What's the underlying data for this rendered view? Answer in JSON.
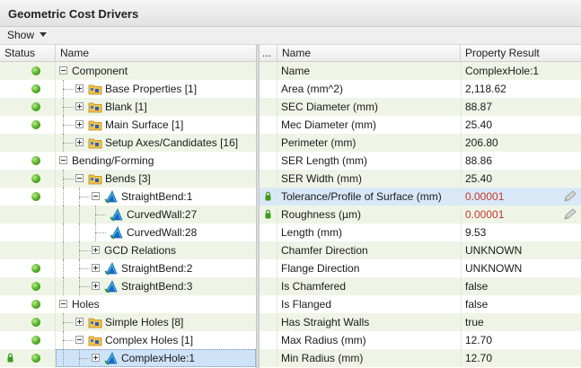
{
  "window": {
    "title": "Geometric Cost Drivers"
  },
  "toolbar": {
    "show_label": "Show"
  },
  "left_table": {
    "headers": {
      "status": "Status",
      "name": "Name"
    },
    "rows": [
      {
        "label": "Component",
        "depth": 0,
        "expander": "minus",
        "icon": "none",
        "status_dot": true,
        "lock": false
      },
      {
        "label": "Base Properties [1]",
        "depth": 1,
        "expander": "plus",
        "icon": "folder",
        "status_dot": true,
        "lock": false
      },
      {
        "label": "Blank [1]",
        "depth": 1,
        "expander": "plus",
        "icon": "folder",
        "status_dot": true,
        "lock": false
      },
      {
        "label": "Main Surface [1]",
        "depth": 1,
        "expander": "plus",
        "icon": "folder",
        "status_dot": true,
        "lock": false
      },
      {
        "label": "Setup Axes/Candidates [16]",
        "depth": 1,
        "expander": "plus",
        "icon": "folder",
        "status_dot": false,
        "lock": false
      },
      {
        "label": "Bending/Forming",
        "depth": 0,
        "expander": "minus",
        "icon": "none",
        "status_dot": true,
        "lock": false
      },
      {
        "label": "Bends [3]",
        "depth": 1,
        "expander": "minus",
        "icon": "folder",
        "status_dot": true,
        "lock": false
      },
      {
        "label": "StraightBend:1",
        "depth": 2,
        "expander": "minus",
        "icon": "feature",
        "status_dot": true,
        "lock": false
      },
      {
        "label": "CurvedWall:27",
        "depth": 3,
        "expander": "none",
        "icon": "feature",
        "status_dot": false,
        "lock": false
      },
      {
        "label": "CurvedWall:28",
        "depth": 3,
        "expander": "none",
        "icon": "feature",
        "status_dot": false,
        "lock": false
      },
      {
        "label": "GCD Relations",
        "depth": 2,
        "expander": "plus",
        "icon": "none",
        "status_dot": false,
        "lock": false
      },
      {
        "label": "StraightBend:2",
        "depth": 2,
        "expander": "plus",
        "icon": "feature",
        "status_dot": true,
        "lock": false
      },
      {
        "label": "StraightBend:3",
        "depth": 2,
        "expander": "plus",
        "icon": "feature",
        "status_dot": true,
        "lock": false
      },
      {
        "label": "Holes",
        "depth": 0,
        "expander": "minus",
        "icon": "none",
        "status_dot": true,
        "lock": false
      },
      {
        "label": "Simple Holes [8]",
        "depth": 1,
        "expander": "plus",
        "icon": "folder",
        "status_dot": true,
        "lock": false
      },
      {
        "label": "Complex Holes [1]",
        "depth": 1,
        "expander": "minus",
        "icon": "folder",
        "status_dot": true,
        "lock": false
      },
      {
        "label": "ComplexHole:1",
        "depth": 2,
        "expander": "plus",
        "icon": "feature",
        "status_dot": true,
        "lock": true,
        "selected": true
      }
    ]
  },
  "right_table": {
    "headers": {
      "marker": "...",
      "name": "Name",
      "result": "Property Result"
    },
    "rows": [
      {
        "name": "Name",
        "value": "ComplexHole:1",
        "lock": false,
        "warn": false,
        "edit": false
      },
      {
        "name": "Area (mm^2)",
        "value": "2,118.62",
        "lock": false,
        "warn": false,
        "edit": false
      },
      {
        "name": "SEC Diameter (mm)",
        "value": "88.87",
        "lock": false,
        "warn": false,
        "edit": false
      },
      {
        "name": "Mec Diameter (mm)",
        "value": "25.40",
        "lock": false,
        "warn": false,
        "edit": false
      },
      {
        "name": "Perimeter (mm)",
        "value": "206.80",
        "lock": false,
        "warn": false,
        "edit": false
      },
      {
        "name": "SER Length (mm)",
        "value": "88.86",
        "lock": false,
        "warn": false,
        "edit": false
      },
      {
        "name": "SER Width (mm)",
        "value": "25.40",
        "lock": false,
        "warn": false,
        "edit": false
      },
      {
        "name": "Tolerance/Profile of Surface (mm)",
        "value": "0.00001",
        "lock": true,
        "warn": true,
        "edit": true,
        "highlight": true
      },
      {
        "name": "Roughness (µm)",
        "value": "0.00001",
        "lock": true,
        "warn": true,
        "edit": true
      },
      {
        "name": "Length (mm)",
        "value": "9.53",
        "lock": false,
        "warn": false,
        "edit": false
      },
      {
        "name": "Chamfer Direction",
        "value": "UNKNOWN",
        "lock": false,
        "warn": false,
        "edit": false
      },
      {
        "name": "Flange Direction",
        "value": "UNKNOWN",
        "lock": false,
        "warn": false,
        "edit": false
      },
      {
        "name": "Is Chamfered",
        "value": "false",
        "lock": false,
        "warn": false,
        "edit": false
      },
      {
        "name": "Is Flanged",
        "value": "false",
        "lock": false,
        "warn": false,
        "edit": false
      },
      {
        "name": "Has Straight Walls",
        "value": "true",
        "lock": false,
        "warn": false,
        "edit": false
      },
      {
        "name": "Max Radius (mm)",
        "value": "12.70",
        "lock": false,
        "warn": false,
        "edit": false
      },
      {
        "name": "Min Radius (mm)",
        "value": "12.70",
        "lock": false,
        "warn": false,
        "edit": false
      }
    ]
  },
  "colors": {
    "row_alt": "#eef5e7",
    "selection": "#cfe3f8",
    "highlight": "#d9e8f7",
    "status_green": "#4aa51c",
    "warn_text": "#c0392b"
  }
}
